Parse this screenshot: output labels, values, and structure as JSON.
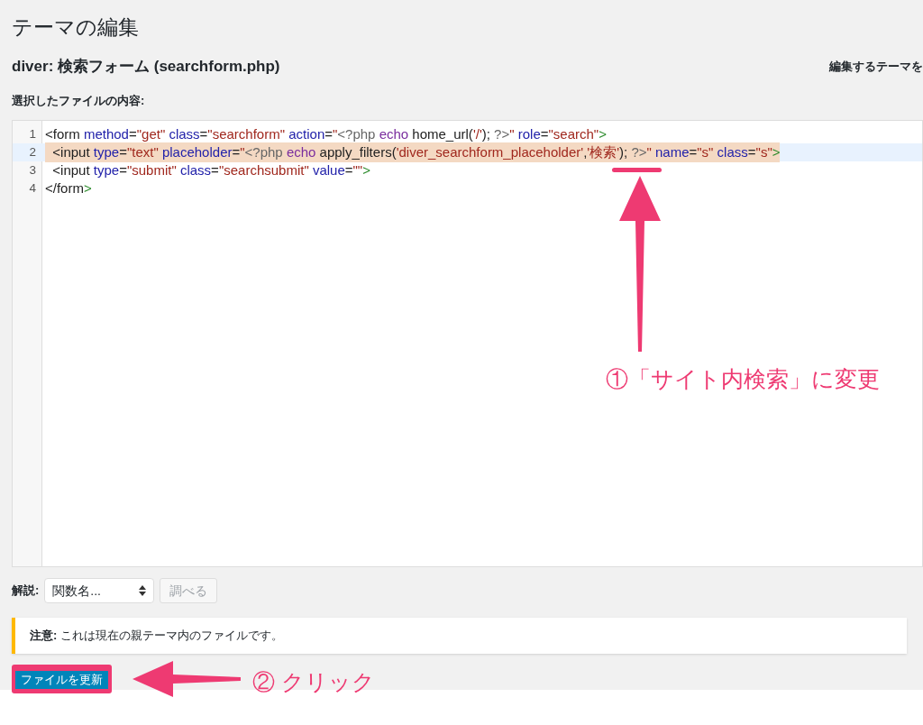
{
  "page_title": "テーマの編集",
  "file_heading": "diver: 検索フォーム (searchform.php)",
  "theme_select_label": "編集するテーマを",
  "content_label": "選択したファイルの内容:",
  "editor": {
    "lines": [
      {
        "number": "1",
        "highlighted": false,
        "tokens": [
          {
            "kind": "tag",
            "text": "<form"
          },
          {
            "kind": "attr",
            "text": " method"
          },
          {
            "kind": "plain",
            "text": "="
          },
          {
            "kind": "str",
            "text": "\"get\""
          },
          {
            "kind": "attr",
            "text": " class"
          },
          {
            "kind": "plain",
            "text": "="
          },
          {
            "kind": "str",
            "text": "\"searchform\""
          },
          {
            "kind": "attr",
            "text": " action"
          },
          {
            "kind": "plain",
            "text": "="
          },
          {
            "kind": "str",
            "text": "\""
          },
          {
            "kind": "meta",
            "text": "<?php"
          },
          {
            "kind": "keyword",
            "text": " echo"
          },
          {
            "kind": "plain",
            "text": " home_url("
          },
          {
            "kind": "str",
            "text": "'/'"
          },
          {
            "kind": "plain",
            "text": ");"
          },
          {
            "kind": "meta",
            "text": " ?>"
          },
          {
            "kind": "str",
            "text": "\""
          },
          {
            "kind": "attr",
            "text": " role"
          },
          {
            "kind": "plain",
            "text": "="
          },
          {
            "kind": "str",
            "text": "\"search\""
          },
          {
            "kind": "bracket",
            "text": ">"
          }
        ]
      },
      {
        "number": "2",
        "highlighted": true,
        "tokens": [
          {
            "kind": "tag",
            "text": "  <input"
          },
          {
            "kind": "attr",
            "text": " type"
          },
          {
            "kind": "plain",
            "text": "="
          },
          {
            "kind": "str",
            "text": "\"text\""
          },
          {
            "kind": "attr",
            "text": " placeholder"
          },
          {
            "kind": "plain",
            "text": "="
          },
          {
            "kind": "str",
            "text": "\""
          },
          {
            "kind": "meta",
            "text": "<?php"
          },
          {
            "kind": "keyword",
            "text": " echo"
          },
          {
            "kind": "plain",
            "text": " apply_filters("
          },
          {
            "kind": "str",
            "text": "'diver_searchform_placeholder'"
          },
          {
            "kind": "plain",
            "text": ","
          },
          {
            "kind": "str",
            "text": "'検索'"
          },
          {
            "kind": "plain",
            "text": ");"
          },
          {
            "kind": "meta",
            "text": " ?>"
          },
          {
            "kind": "str",
            "text": "\""
          },
          {
            "kind": "attr",
            "text": " name"
          },
          {
            "kind": "plain",
            "text": "="
          },
          {
            "kind": "str",
            "text": "\"s\""
          },
          {
            "kind": "attr",
            "text": " class"
          },
          {
            "kind": "plain",
            "text": "="
          },
          {
            "kind": "str",
            "text": "\"s\""
          },
          {
            "kind": "bracket",
            "text": ">"
          }
        ]
      },
      {
        "number": "3",
        "highlighted": false,
        "tokens": [
          {
            "kind": "tag",
            "text": "  <input"
          },
          {
            "kind": "attr",
            "text": " type"
          },
          {
            "kind": "plain",
            "text": "="
          },
          {
            "kind": "str",
            "text": "\"submit\""
          },
          {
            "kind": "attr",
            "text": " class"
          },
          {
            "kind": "plain",
            "text": "="
          },
          {
            "kind": "str",
            "text": "\"searchsubmit\""
          },
          {
            "kind": "attr",
            "text": " value"
          },
          {
            "kind": "plain",
            "text": "="
          },
          {
            "kind": "str",
            "text": "\"\""
          },
          {
            "kind": "bracket",
            "text": ">"
          }
        ]
      },
      {
        "number": "4",
        "highlighted": false,
        "tokens": [
          {
            "kind": "tag",
            "text": "</form"
          },
          {
            "kind": "bracket",
            "text": ">"
          }
        ]
      }
    ]
  },
  "docs": {
    "label": "解説:",
    "select_value": "関数名...",
    "lookup_button": "調べる",
    "lookup_disabled": true
  },
  "notice": {
    "strong": "注意:",
    "text": "これは現在の親テーマ内のファイルです。"
  },
  "update_button": "ファイルを更新",
  "annotations": {
    "step1": "①「サイト内検索」に変更",
    "step2": "② クリック"
  }
}
